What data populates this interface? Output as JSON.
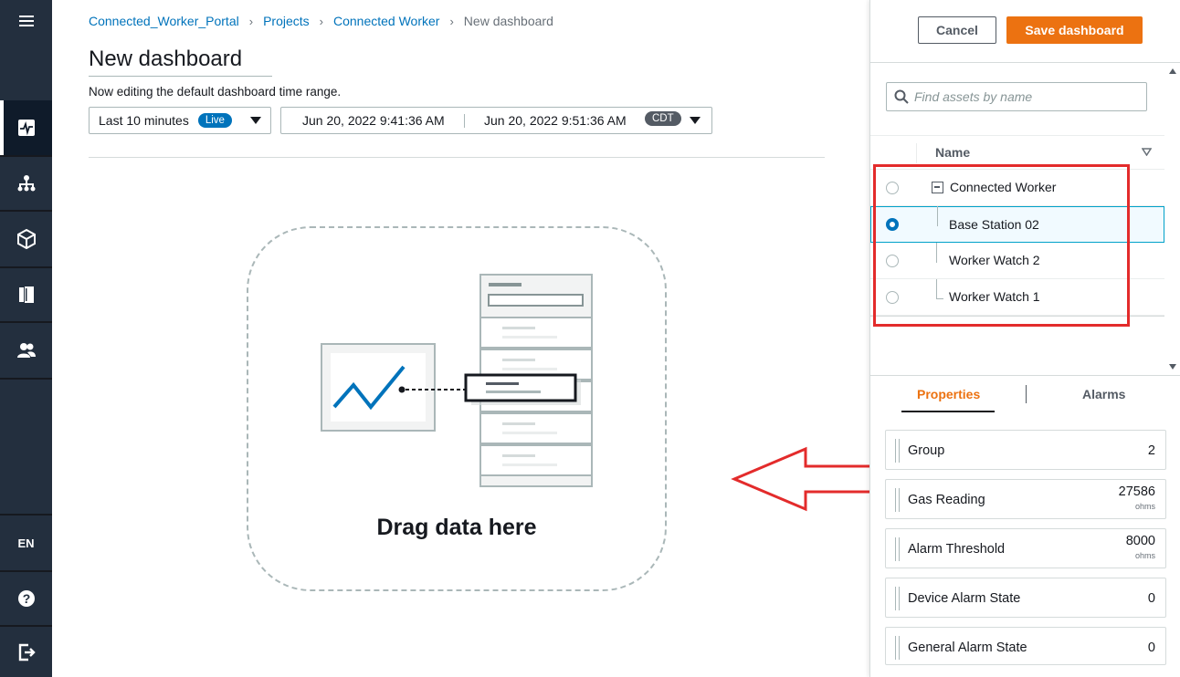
{
  "breadcrumb": {
    "items": [
      "Connected_Worker_Portal",
      "Projects",
      "Connected Worker"
    ],
    "current": "New dashboard",
    "separator": "›"
  },
  "page": {
    "title": "New dashboard",
    "subtitle": "Now editing the default dashboard time range."
  },
  "time_range": {
    "preset": "Last 10 minutes",
    "live_badge": "Live",
    "start": "Jun 20, 2022 9:41:36 AM",
    "end": "Jun 20, 2022 9:51:36 AM",
    "timezone": "CDT"
  },
  "drop_zone": {
    "label": "Drag data here"
  },
  "rail": {
    "items": [
      "menu-icon",
      "dashboard-icon",
      "hierarchy-icon",
      "cube-icon",
      "book-icon",
      "users-icon"
    ],
    "language": "EN",
    "bottom": [
      "help-icon",
      "signout-icon"
    ]
  },
  "panel": {
    "cancel_label": "Cancel",
    "save_label": "Save dashboard",
    "search_placeholder": "Find assets by name",
    "table_header": "Name",
    "tree": [
      {
        "label": "Connected Worker",
        "selected": false
      },
      {
        "label": "Base Station 02",
        "selected": true
      },
      {
        "label": "Worker Watch 2",
        "selected": false
      },
      {
        "label": "Worker Watch 1",
        "selected": false
      }
    ],
    "tabs": [
      "Properties",
      "Alarms"
    ],
    "active_tab": "Properties",
    "properties": [
      {
        "label": "Group",
        "value": "2",
        "unit": ""
      },
      {
        "label": "Gas Reading",
        "value": "27586",
        "unit": "ohms"
      },
      {
        "label": "Alarm Threshold",
        "value": "8000",
        "unit": "ohms"
      },
      {
        "label": "Device Alarm State",
        "value": "0",
        "unit": ""
      },
      {
        "label": "General Alarm State",
        "value": "0",
        "unit": ""
      }
    ]
  },
  "colors": {
    "rail_bg": "#232f3e",
    "link": "#0073bb",
    "accent_orange": "#ec7211",
    "annotation_red": "#e32b2b"
  }
}
